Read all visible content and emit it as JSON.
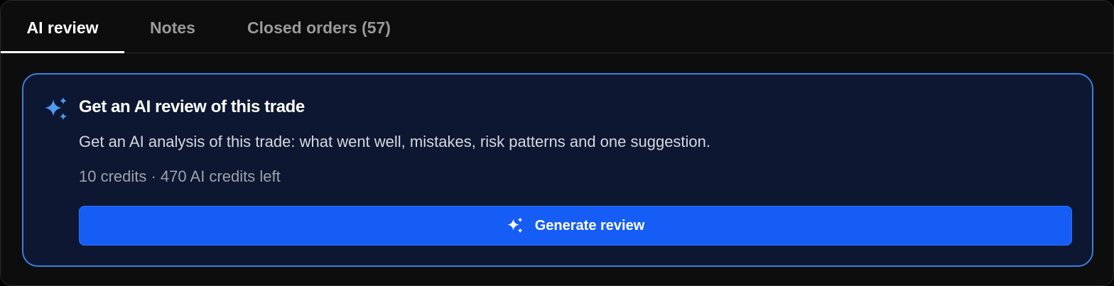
{
  "tabs": [
    {
      "label": "AI review",
      "active": true
    },
    {
      "label": "Notes",
      "active": false
    },
    {
      "label": "Closed orders (57)",
      "active": false
    }
  ],
  "card": {
    "icon": "sparkles-icon",
    "title": "Get an AI review of this trade",
    "description": "Get an AI analysis of this trade: what went well, mistakes, risk patterns and one suggestion.",
    "credits": "10 credits · 470 AI credits left",
    "button": {
      "icon": "sparkles-icon",
      "label": "Generate review"
    }
  },
  "colors": {
    "accent": "#165df5",
    "card_border": "#3a7fe0",
    "card_background": "#0d1731",
    "icon": "#4e9bf2"
  }
}
